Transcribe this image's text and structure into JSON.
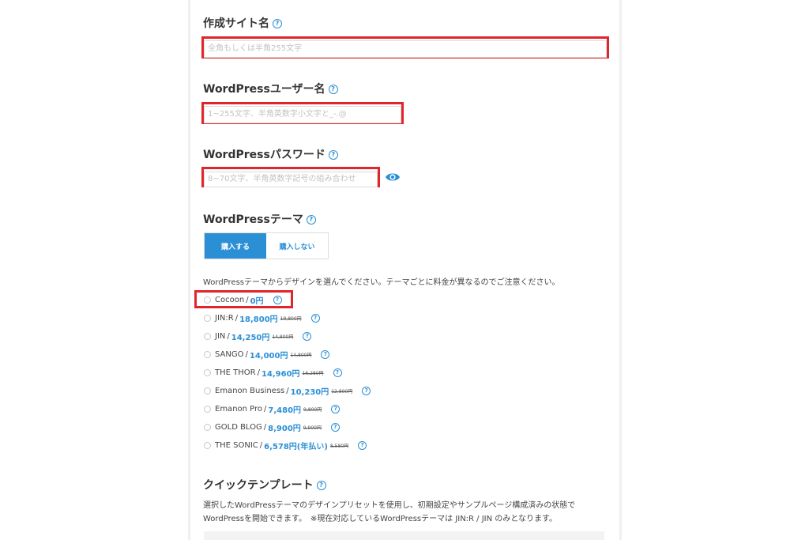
{
  "site_name": {
    "title": "作成サイト名",
    "placeholder": "全角もしくは半角255文字"
  },
  "wp_user": {
    "title": "WordPressユーザー名",
    "placeholder": "1~255文字、半角英数字小文字と_-.@"
  },
  "wp_password": {
    "title": "WordPressパスワード",
    "placeholder": "8~70文字、半角英数字記号の組み合わせ",
    "toggle_icon": "eye-icon"
  },
  "wp_theme": {
    "title": "WordPressテーマ",
    "buy_label": "購入する",
    "no_buy_label": "購入しない",
    "description": "WordPressテーマからデザインを選んでください。テーマごとに料金が異なるのでご注意ください。",
    "options": [
      {
        "name": "Cocoon",
        "price": "0円",
        "old_price": ""
      },
      {
        "name": "JIN:R",
        "price": "18,800円",
        "old_price": "19,800円"
      },
      {
        "name": "JIN",
        "price": "14,250円",
        "old_price": "14,800円"
      },
      {
        "name": "SANGO",
        "price": "14,000円",
        "old_price": "14,800円"
      },
      {
        "name": "THE THOR",
        "price": "14,960円",
        "old_price": "16,280円"
      },
      {
        "name": "Emanon Business",
        "price": "10,230円",
        "old_price": "12,800円"
      },
      {
        "name": "Emanon Pro",
        "price": "7,480円",
        "old_price": "9,800円"
      },
      {
        "name": "GOLD BLOG",
        "price": "8,900円",
        "old_price": "9,900円"
      },
      {
        "name": "THE SONIC",
        "price": "6,578円(年払い)",
        "old_price": "8,580円"
      }
    ]
  },
  "quick_template": {
    "title": "クイックテンプレート",
    "description": "選択したWordPressテーマのデザインプリセットを使用し、初期設定やサンプルページ構成済みの状態でWordPressを開始できます。　※現在対応しているWordPressテーマは JIN:R / JIN のみとなります。"
  },
  "colors": {
    "accent": "#2b8fd6",
    "highlight": "#e0262b"
  }
}
